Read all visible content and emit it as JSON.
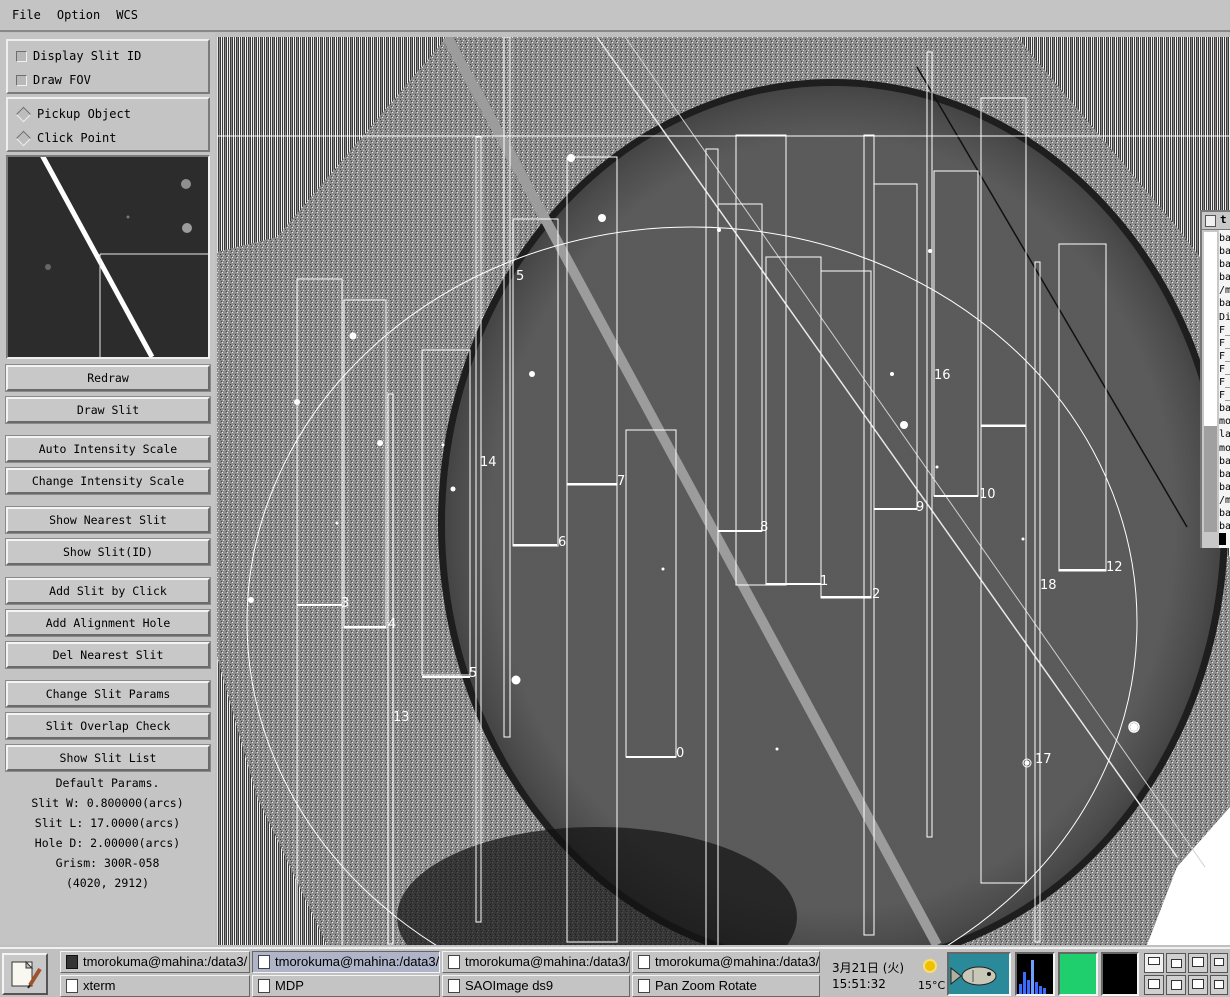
{
  "menubar": {
    "items": [
      "File",
      "Option",
      "WCS"
    ]
  },
  "options": {
    "display_slit_id": "Display Slit ID",
    "draw_fov": "Draw FOV",
    "pickup_object": "Pickup Object",
    "click_point": "Click Point"
  },
  "buttons": {
    "redraw": "Redraw",
    "draw_slit": "Draw Slit",
    "auto_intensity_scale": "Auto Intensity Scale",
    "change_intensity_scale": "Change Intensity Scale",
    "show_nearest_slit": "Show Nearest Slit",
    "show_slit_id": "Show Slit(ID)",
    "add_slit_by_click": "Add Slit by Click",
    "add_alignment_hole": "Add Alignment Hole",
    "del_nearest_slit": "Del Nearest Slit",
    "change_slit_params": "Change Slit Params",
    "slit_overlap_check": "Slit Overlap Check",
    "show_slit_list": "Show Slit List"
  },
  "params": {
    "heading": "Default Params.",
    "slit_w": "Slit W: 0.800000(arcs)",
    "slit_l": "Slit L: 17.0000(arcs)",
    "hole_d": "Hole D: 2.00000(arcs)",
    "grism": "Grism: 300R-058",
    "coords": "(4020, 2912)"
  },
  "slit_labels": [
    "5",
    "14",
    "7",
    "6",
    "8",
    "16",
    "9",
    "10",
    "1",
    "2",
    "3",
    "4",
    "5",
    "13",
    "0",
    "18",
    "12",
    "17"
  ],
  "terminal": {
    "title": "t",
    "lines": [
      "ba",
      "ba",
      "ba",
      "ba",
      "/m",
      "ba",
      "Di",
      "F_",
      "F_",
      "F_",
      "F_",
      "F_",
      "F_",
      "ba",
      "mo",
      "la",
      "mo",
      "ba",
      "ba",
      "ba",
      "/m",
      "ba",
      "ba"
    ]
  },
  "taskbar": {
    "tasks_top": [
      "tmorokuma@mahina:/data3/",
      "tmorokuma@mahina:/data3/",
      "tmorokuma@mahina:/data3/",
      "tmorokuma@mahina:/data3/"
    ],
    "tasks_bottom": [
      "xterm",
      "MDP",
      "SAOImage ds9",
      "Pan Zoom Rotate"
    ],
    "date": "3月21日 (火)",
    "time": "15:51:32",
    "temperature": "15°C"
  },
  "colors": {
    "panel": "#c4c4c4",
    "image_bg": "#3b3b3b",
    "slit_line": "#ffffff",
    "active_task": "#b0b4c8",
    "monitor_green": "#1fcf6e",
    "fish_panel": "#2a8a9a"
  }
}
